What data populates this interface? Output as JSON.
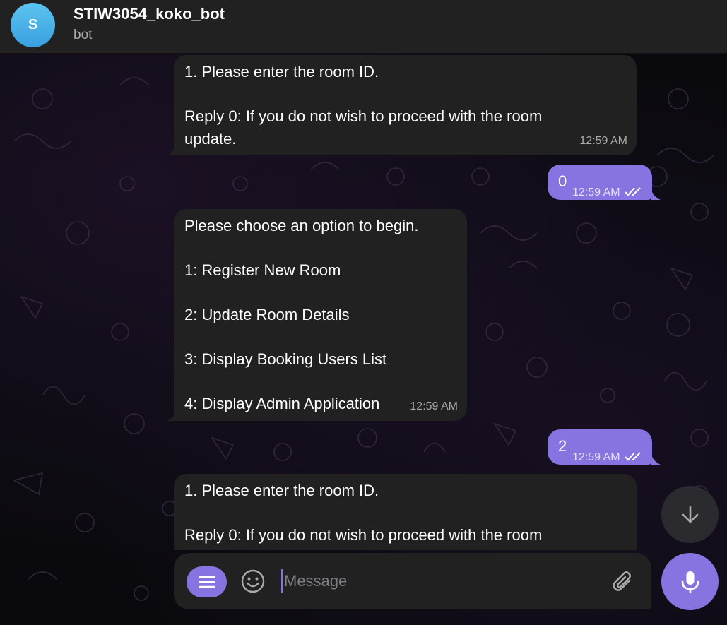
{
  "chat": {
    "avatar_letter": "S",
    "title": "STIW3054_koko_bot",
    "subtitle": "bot"
  },
  "messages": [
    {
      "from": "bot",
      "text": "1. Please enter the room ID.\n\nReply 0: If you do not wish to proceed with the room\nupdate.",
      "time": "12:59 AM"
    },
    {
      "from": "me",
      "text": "0",
      "time": "12:59 AM",
      "status": "read"
    },
    {
      "from": "bot",
      "text": "Please choose an option to begin.\n\n1: Register New Room\n\n2: Update Room Details\n\n3: Display Booking Users List\n\n4: Display Admin Application",
      "time": "12:59 AM"
    },
    {
      "from": "me",
      "text": "2",
      "time": "12:59 AM",
      "status": "read"
    },
    {
      "from": "bot",
      "text": "1. Please enter the room ID.\n\nReply 0: If you do not wish to proceed with the room",
      "time": ""
    }
  ],
  "composer": {
    "placeholder": "Message"
  },
  "icons": {
    "menu": "menu-icon",
    "emoji": "smile-icon",
    "attach": "paperclip-icon",
    "mic": "microphone-icon",
    "scroll_down": "arrow-down-icon",
    "read_check": "double-check-icon"
  },
  "colors": {
    "accent": "#8774e1",
    "header_bg": "#212121",
    "bubble_in": "#212121",
    "avatar": "#4aaee8"
  }
}
